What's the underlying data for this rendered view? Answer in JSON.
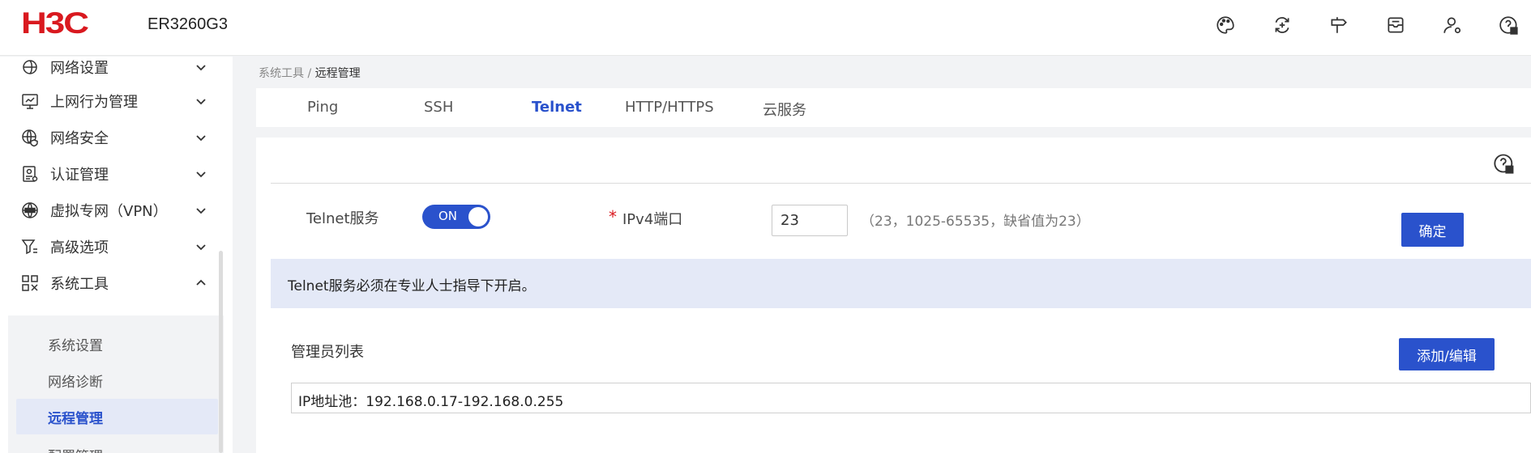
{
  "header": {
    "logo": "H3C",
    "model": "ER3260G3",
    "icons": [
      "palette-icon",
      "sync-icon",
      "signpost-icon",
      "mail-icon",
      "user-settings-icon",
      "help-icon"
    ]
  },
  "sidebar": {
    "items": [
      {
        "label": "网络设置",
        "icon": "network-settings-icon",
        "expanded": false
      },
      {
        "label": "上网行为管理",
        "icon": "monitor-icon",
        "expanded": false
      },
      {
        "label": "网络安全",
        "icon": "globe-shield-icon",
        "expanded": false
      },
      {
        "label": "认证管理",
        "icon": "id-card-icon",
        "expanded": false
      },
      {
        "label": "虚拟专网（VPN）",
        "icon": "vpn-globe-icon",
        "expanded": false
      },
      {
        "label": "高级选项",
        "icon": "filter-icon",
        "expanded": false
      },
      {
        "label": "系统工具",
        "icon": "tools-icon",
        "expanded": true
      }
    ],
    "subitems": [
      {
        "label": "系统设置",
        "active": false
      },
      {
        "label": "网络诊断",
        "active": false
      },
      {
        "label": "远程管理",
        "active": true
      },
      {
        "label": "配置管理",
        "active": false
      }
    ]
  },
  "breadcrumb": {
    "parent": "系统工具",
    "separator": " / ",
    "current": "远程管理"
  },
  "tabs": [
    {
      "label": "Ping",
      "active": false
    },
    {
      "label": "SSH",
      "active": false
    },
    {
      "label": "Telnet",
      "active": true
    },
    {
      "label": "HTTP/HTTPS",
      "active": false
    },
    {
      "label": "云服务",
      "active": false
    }
  ],
  "telnet": {
    "service_label": "Telnet服务",
    "toggle_label": "ON",
    "toggle_on": true,
    "required_mark": "*",
    "port_label": "IPv4端口",
    "port_value": "23",
    "port_hint": "（23，1025-65535，缺省值为23）",
    "confirm_label": "确定",
    "notice": "Telnet服务必须在专业人士指导下开启。",
    "admin_list_label": "管理员列表",
    "add_edit_label": "添加/编辑",
    "ip_pool": "IP地址池：192.168.0.17-192.168.0.255"
  },
  "colors": {
    "accent": "#2a52cc",
    "brand_red": "#d9191f",
    "notice_bg": "#e4e9f7"
  }
}
